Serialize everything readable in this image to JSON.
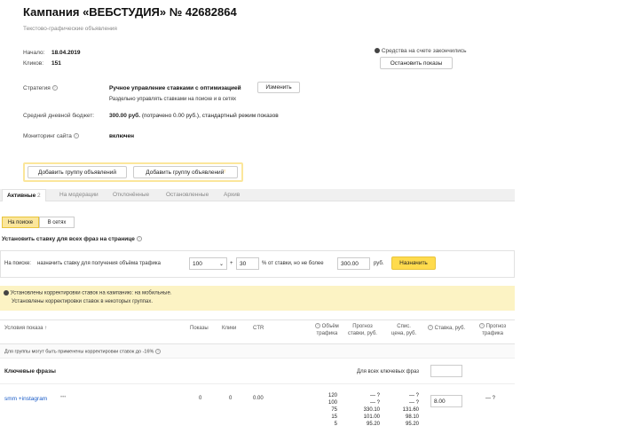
{
  "header": {
    "title": "Кампания «ВЕБСТУДИЯ» № 42682864",
    "subtitle": "Текстово-графические объявления"
  },
  "meta": {
    "start_label": "Начало:",
    "start_value": "18.04.2019",
    "clicks_label": "Кликов:",
    "clicks_value": "151",
    "funds_notice": "Средства на счете закончились",
    "stop_button": "Остановить показы"
  },
  "strategy": {
    "label": "Стратегия",
    "value": "Ручное управление ставками с оптимизацией",
    "change_button": "Изменить",
    "note": "Раздельно управлять ставками на поиске и в сетях"
  },
  "budget": {
    "label": "Средний дневной бюджет:",
    "value": "300.00 руб.",
    "rest": "(потрачено 0.00 руб.), стандартный режим показов"
  },
  "monitoring": {
    "label": "Мониторинг сайта",
    "value": "включен"
  },
  "actions": {
    "add_group_1": "Добавить группу объявлений",
    "add_group_2": "Добавить группу объявлений"
  },
  "tabs": [
    {
      "label": "Активные",
      "count": "2"
    },
    {
      "label": "На модерации"
    },
    {
      "label": "Отклонённые"
    },
    {
      "label": "Остановленные"
    },
    {
      "label": "Архив"
    }
  ],
  "segments": {
    "search": "На поиске",
    "networks": "В сетях"
  },
  "bid_setting": {
    "heading": "Установить ставку для всех фраз на странице",
    "prefix": "На поиске:",
    "text1": "назначить ставку для получения объёма трафика",
    "traffic_value": "100",
    "plus": "+",
    "percent_value": "30",
    "text2": "% от ставки, но не более",
    "max_value": "300.00",
    "currency": "руб.",
    "apply_button": "Назначить"
  },
  "alert": {
    "line1": "Установлены корректировки ставок на кампанию: на мобильные.",
    "line2": "Установлены корректировки ставок в некоторых группах."
  },
  "table": {
    "col_conditions": "Условия показа",
    "col_impressions": "Показы",
    "col_clicks": "Клики",
    "col_ctr": "CTR",
    "col_volume_1": "Объём",
    "col_volume_2": "трафика",
    "col_forecast_1": "Прогноз",
    "col_forecast_2": "ставки, руб.",
    "col_price_1": "Спис.",
    "col_price_2": "цена, руб.",
    "col_bid": "Ставка, руб.",
    "col_tforecast_1": "Прогноз",
    "col_tforecast_2": "трафика",
    "group_note": "Для группы могут быть применены корректировки ставок до -16%",
    "keywords_heading": "Ключевые фразы",
    "all_phrases": "Для всех ключевых фраз"
  },
  "row": {
    "phrase": "smm +instagram",
    "impressions": "0",
    "clicks": "0",
    "ctr": "0.00",
    "volumes": [
      "120",
      "100",
      "75",
      "15",
      "5"
    ],
    "forecast": [
      "— ?",
      "— ?",
      "330.10",
      "101.00",
      "95.20"
    ],
    "prices": [
      "— ?",
      "— ?",
      "131.60",
      "98.10",
      "95.20"
    ],
    "bid": "8.00",
    "traffic_forecast": "— ?"
  }
}
